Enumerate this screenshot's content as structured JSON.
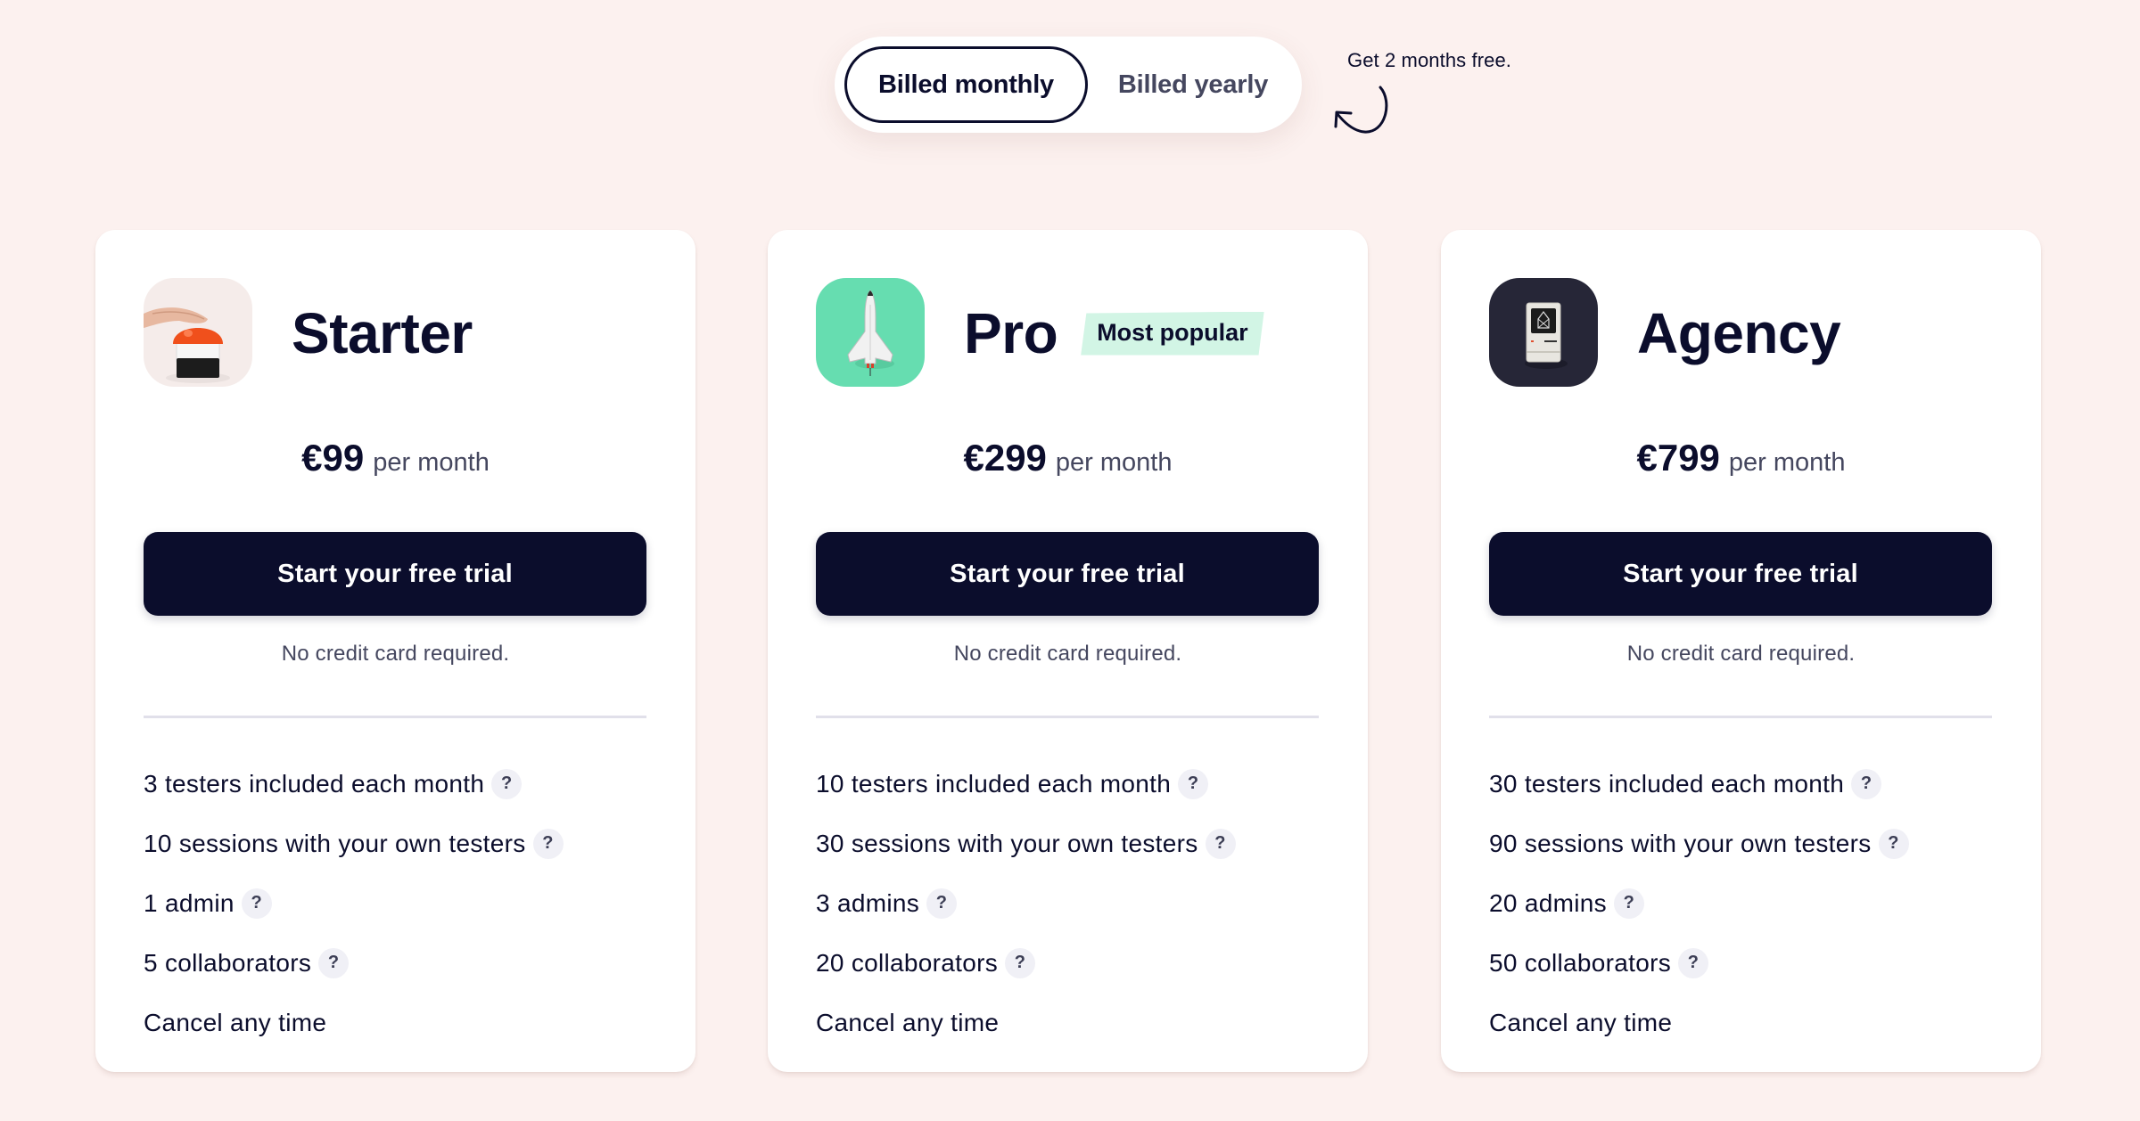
{
  "billing_toggle": {
    "options": [
      {
        "label": "Billed monthly",
        "selected": true
      },
      {
        "label": "Billed yearly",
        "selected": false
      }
    ],
    "promo_note": "Get 2 months free."
  },
  "plans": [
    {
      "name": "Starter",
      "icon": "red-push-button-icon",
      "badge": null,
      "price": "€99",
      "period": "per month",
      "cta_label": "Start your free trial",
      "cta_note": "No credit card required.",
      "features": [
        {
          "text": "3 testers included each month",
          "help": true
        },
        {
          "text": "10 sessions with your own testers",
          "help": true
        },
        {
          "text": "1 admin",
          "help": true
        },
        {
          "text": "5 collaborators",
          "help": true
        },
        {
          "text": "Cancel any time",
          "help": false
        }
      ]
    },
    {
      "name": "Pro",
      "icon": "space-shuttle-icon",
      "badge": "Most popular",
      "price": "€299",
      "period": "per month",
      "cta_label": "Start your free trial",
      "cta_note": "No credit card required.",
      "features": [
        {
          "text": "10 testers included each month",
          "help": true
        },
        {
          "text": "30 sessions with your own testers",
          "help": true
        },
        {
          "text": "3 admins",
          "help": true
        },
        {
          "text": "20 collaborators",
          "help": true
        },
        {
          "text": "Cancel any time",
          "help": false
        }
      ]
    },
    {
      "name": "Agency",
      "icon": "retro-computer-icon",
      "badge": null,
      "price": "€799",
      "period": "per month",
      "cta_label": "Start your free trial",
      "cta_note": "No credit card required.",
      "features": [
        {
          "text": "30 testers included each month",
          "help": true
        },
        {
          "text": "90 sessions with your own testers",
          "help": true
        },
        {
          "text": "20 admins",
          "help": true
        },
        {
          "text": "50 collaborators",
          "help": true
        },
        {
          "text": "Cancel any time",
          "help": false
        }
      ]
    }
  ],
  "help_glyph": "?",
  "colors": {
    "background": "#fcf1ef",
    "primary": "#0b0d2c",
    "badge_bg": "#d2f5e5",
    "pro_icon_bg": "#66ddb0",
    "agency_icon_bg": "#262637"
  }
}
